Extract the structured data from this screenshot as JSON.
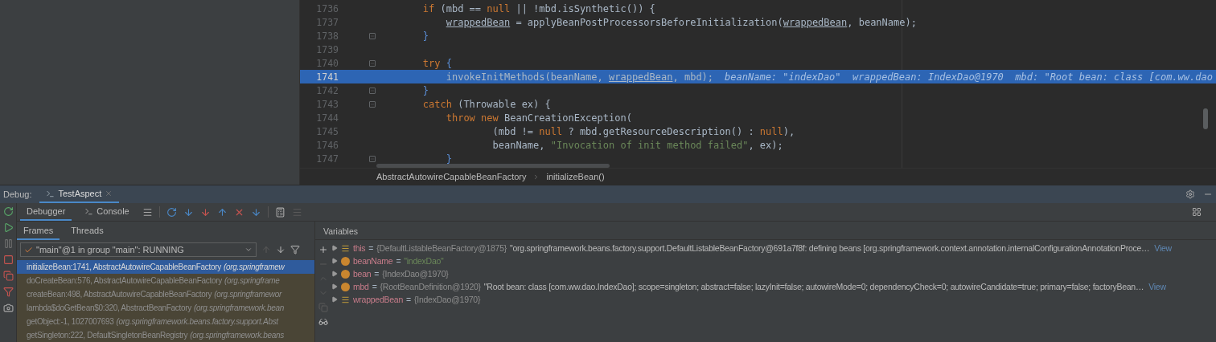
{
  "editor": {
    "lines": [
      {
        "number": "1736",
        "fold": false,
        "highlighted": false,
        "tokens": [
          {
            "kind": "kw",
            "text": "        if"
          },
          {
            "kind": "plain",
            "text": " (mbd == "
          },
          {
            "kind": "kw",
            "text": "null"
          },
          {
            "kind": "plain",
            "text": " || !mbd.isSynthetic()) {"
          }
        ]
      },
      {
        "number": "1737",
        "fold": false,
        "highlighted": false,
        "tokens": [
          {
            "kind": "var",
            "text": "            wrappedBean"
          },
          {
            "kind": "plain",
            "text": " = applyBeanPostProcessorsBeforeInitialization("
          },
          {
            "kind": "var",
            "text": "wrappedBean"
          },
          {
            "kind": "plain",
            "text": ", beanName);"
          }
        ]
      },
      {
        "number": "1738",
        "fold": true,
        "highlighted": false,
        "tokens": [
          {
            "kind": "bracket",
            "text": "        }"
          }
        ]
      },
      {
        "number": "1739",
        "fold": false,
        "highlighted": false
      },
      {
        "number": "1740",
        "fold": true,
        "highlighted": false,
        "tokens": [
          {
            "kind": "kw",
            "text": "        try"
          },
          {
            "kind": "bracket",
            "text": " {"
          }
        ]
      },
      {
        "number": "1741",
        "fold": false,
        "highlighted": true,
        "tokens": [
          {
            "kind": "plain",
            "text": "            invokeInitMethods(beanName, "
          },
          {
            "kind": "var",
            "text": "wrappedBean"
          },
          {
            "kind": "plain",
            "text": ", mbd);"
          }
        ],
        "inline_values": "beanName: \"indexDao\"  wrappedBean: IndexDao@1970  mbd: \"Root bean: class [com.ww.dao"
      },
      {
        "number": "1742",
        "fold": true,
        "highlighted": false,
        "tokens": [
          {
            "kind": "bracket",
            "text": "        }"
          }
        ]
      },
      {
        "number": "1743",
        "fold": true,
        "highlighted": false,
        "tokens": [
          {
            "kind": "kw",
            "text": "        catch"
          },
          {
            "kind": "plain",
            "text": " (Throwable ex) {"
          }
        ]
      },
      {
        "number": "1744",
        "fold": false,
        "highlighted": false,
        "tokens": [
          {
            "kind": "kw",
            "text": "            throw new"
          },
          {
            "kind": "plain",
            "text": " BeanCreationException("
          }
        ]
      },
      {
        "number": "1745",
        "fold": false,
        "highlighted": false,
        "tokens": [
          {
            "kind": "plain",
            "text": "                    (mbd != "
          },
          {
            "kind": "kw",
            "text": "null"
          },
          {
            "kind": "plain",
            "text": " ? mbd.getResourceDescription() : "
          },
          {
            "kind": "kw",
            "text": "null"
          },
          {
            "kind": "plain",
            "text": "),"
          }
        ]
      },
      {
        "number": "1746",
        "fold": false,
        "highlighted": false,
        "tokens": [
          {
            "kind": "plain",
            "text": "                    beanName, "
          },
          {
            "kind": "str",
            "text": "\"Invocation of init method failed\""
          },
          {
            "kind": "plain",
            "text": ", ex);"
          }
        ]
      },
      {
        "number": "1747",
        "fold": true,
        "highlighted": false,
        "tokens": [
          {
            "kind": "bracket",
            "text": "            }"
          }
        ]
      }
    ],
    "breadcrumb": [
      "AbstractAutowireCapableBeanFactory",
      "initializeBean()"
    ]
  },
  "debug": {
    "label": "Debug:",
    "session_tab": "TestAspect",
    "tabs": [
      {
        "label": "Debugger",
        "selected": true
      },
      {
        "label": "Console",
        "selected": false
      }
    ],
    "frame_tabs": [
      {
        "label": "Frames",
        "selected": true
      },
      {
        "label": "Threads",
        "selected": false
      }
    ],
    "thread": "\"main\"@1 in group \"main\": RUNNING",
    "frames": [
      {
        "method": "initializeBean:1741, AbstractAutowireCapableBeanFactory",
        "package": "(org.springframew",
        "selected": true,
        "library": false
      },
      {
        "method": "doCreateBean:576, AbstractAutowireCapableBeanFactory",
        "package": "(org.springframe",
        "selected": false,
        "library": true
      },
      {
        "method": "createBean:498, AbstractAutowireCapableBeanFactory",
        "package": "(org.springframewor",
        "selected": false,
        "library": true
      },
      {
        "method": "lambda$doGetBean$0:320, AbstractBeanFactory",
        "package": "(org.springframework.bean",
        "selected": false,
        "library": true
      },
      {
        "method": "getObject:-1, 1027007693",
        "package": "(org.springframework.beans.factory.support.Abst",
        "selected": false,
        "library": true
      },
      {
        "method": "getSingleton:222, DefaultSingletonBeanRegistry",
        "package": "(org.springframework.beans",
        "selected": false,
        "library": true
      }
    ],
    "variables_title": "Variables",
    "variables": [
      {
        "kind": "field",
        "name": "this",
        "operator": "=",
        "type": "{DefaultListableBeanFactory@1875}",
        "value": "\"org.springframework.beans.factory.support.DefaultListableBeanFactory@691a7f8f: defining beans [org.springframework.context.annotation.internalConfigurationAnnotationProce…",
        "link": "View"
      },
      {
        "kind": "param",
        "name": "beanName",
        "operator": "=",
        "string": "\"indexDao\""
      },
      {
        "kind": "param",
        "name": "bean",
        "operator": "=",
        "type": "{IndexDao@1970}"
      },
      {
        "kind": "param",
        "name": "mbd",
        "operator": "=",
        "type": "{RootBeanDefinition@1920}",
        "value": "\"Root bean: class [com.ww.dao.IndexDao]; scope=singleton; abstract=false; lazyInit=false; autowireMode=0; dependencyCheck=0; autowireCandidate=true; primary=false; factoryBean…",
        "link": "View"
      },
      {
        "kind": "field",
        "name": "wrappedBean",
        "operator": "=",
        "type": "{IndexDao@1970}"
      }
    ]
  }
}
